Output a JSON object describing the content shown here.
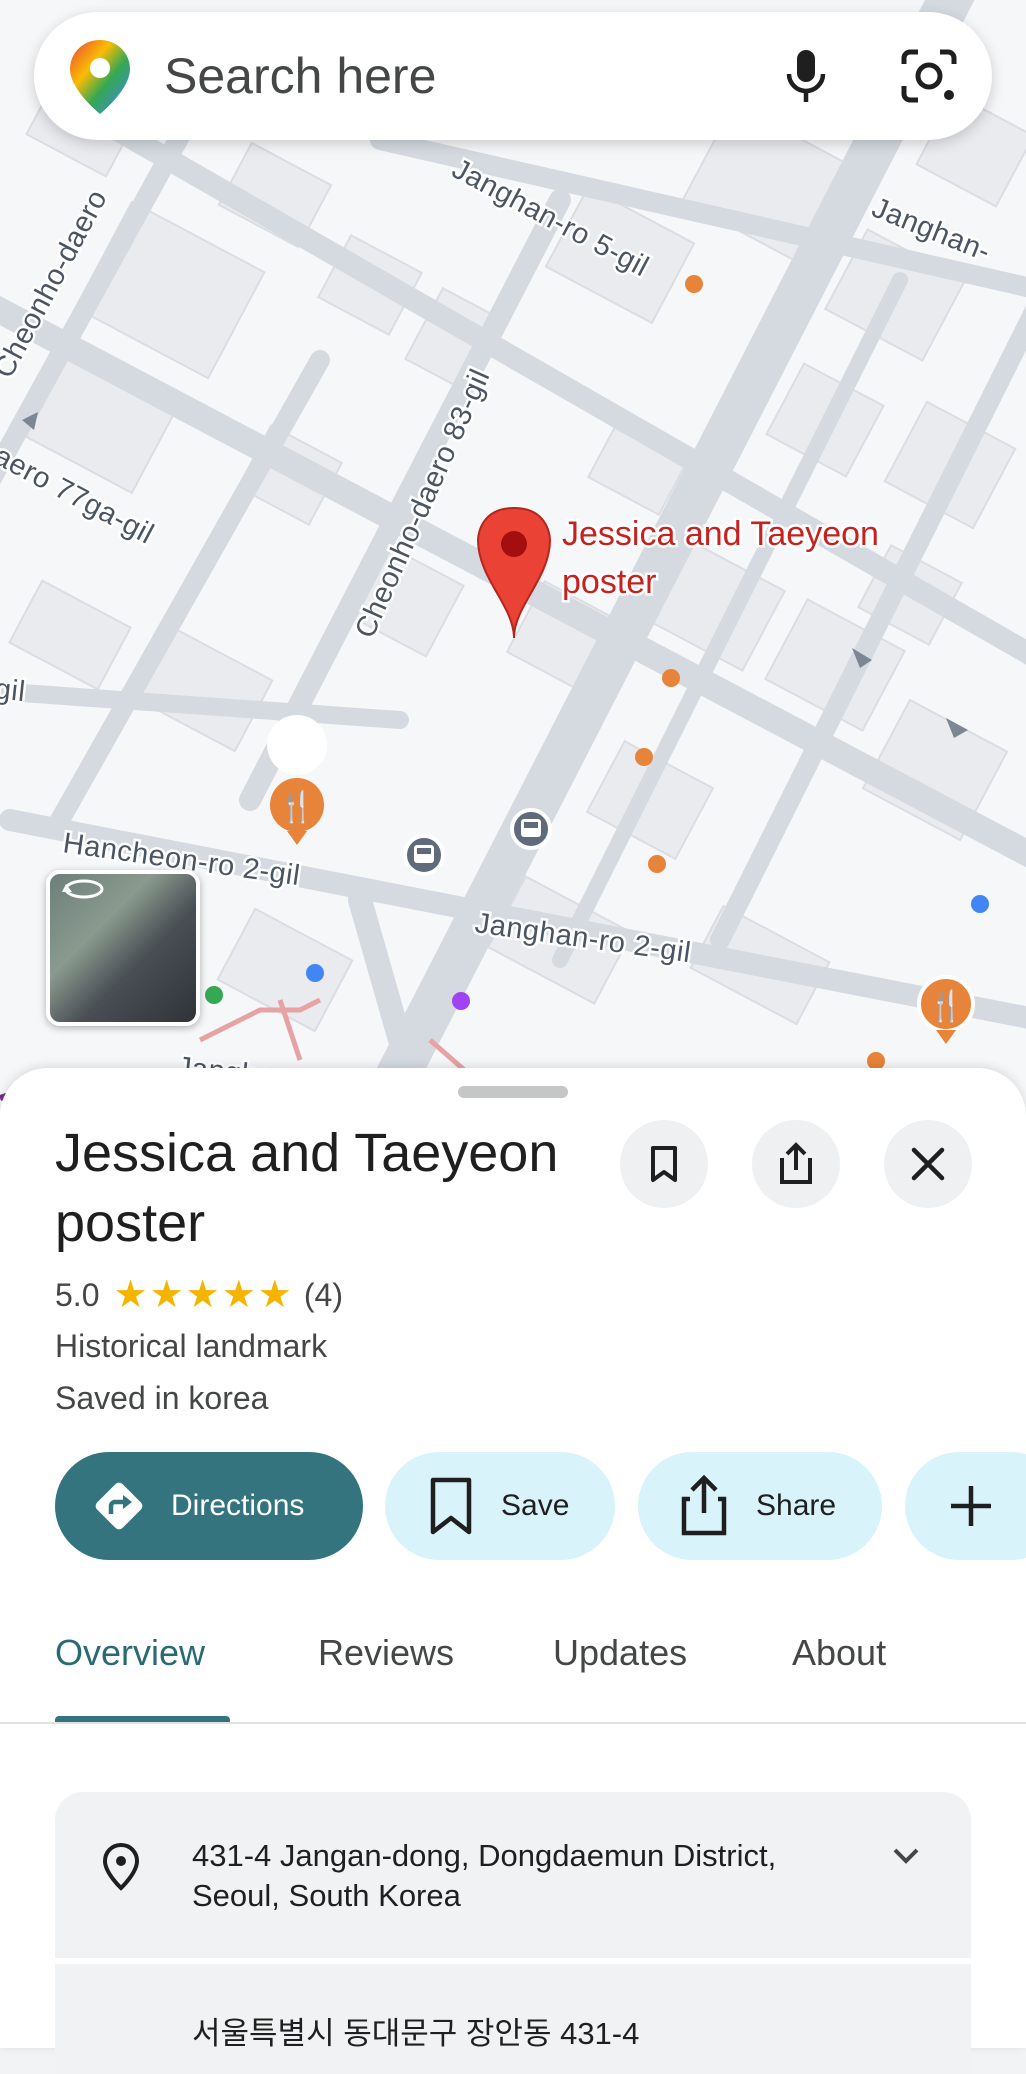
{
  "search": {
    "placeholder": "Search here"
  },
  "map": {
    "pin_label_line1": "Jessica and Taeyeon",
    "pin_label_line2": "poster",
    "roads": [
      "Cheonho-daero",
      "Janghan-ro 5-gil",
      "Janghan-",
      "Cheonho-daero 83-gil",
      "aero 77ga-gil",
      "gil",
      "Hancheon-ro 2-gil",
      "Janghan-ro 2-gil",
      "Janghanpyeong"
    ]
  },
  "place": {
    "title": "Jessica and Taeyeon poster",
    "rating": "5.0",
    "stars": 5,
    "review_count": "(4)",
    "category": "Historical landmark",
    "saved_in": "Saved in korea"
  },
  "actions": {
    "directions": "Directions",
    "save": "Save",
    "share": "Share"
  },
  "tabs": [
    "Overview",
    "Reviews",
    "Updates",
    "About"
  ],
  "address": {
    "line": "431-4 Jangan-dong, Dongdaemun District, Seoul, South Korea",
    "korean": "서울특별시 동대문구 장안동 431-4"
  },
  "colors": {
    "accent": "#33747f",
    "pin": "#ea4335",
    "pin_label": "#c5221f",
    "tonal_button": "#d9f3fb",
    "star": "#f5b400"
  }
}
